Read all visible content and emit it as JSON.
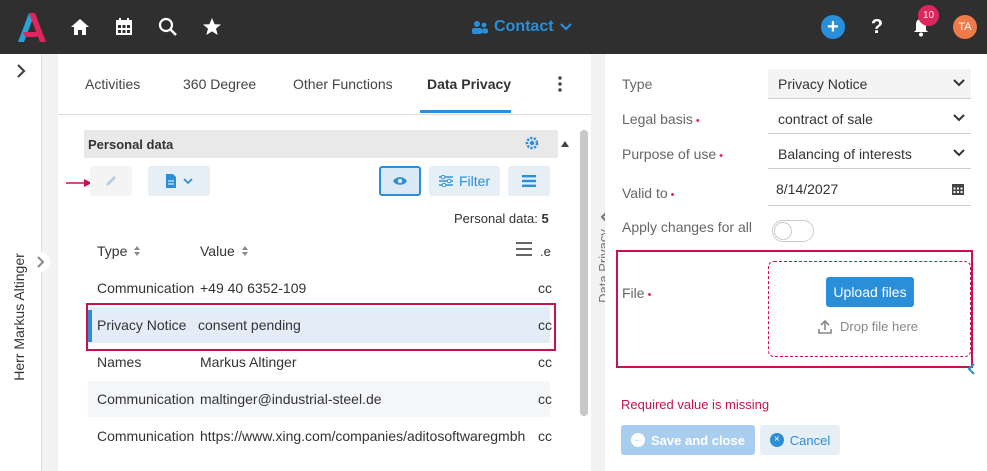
{
  "topbar": {
    "context_label": "Contact",
    "notification_count": "10",
    "user_initials": "TA",
    "icons": [
      "home-icon",
      "calendar-icon",
      "search-icon",
      "star-icon",
      "add-icon",
      "help-icon",
      "bell-icon"
    ],
    "colors": {
      "bar": "#2f2f2f",
      "accent": "#2a8fd8",
      "badge": "#e0245e",
      "avatar": "#ef7b4b"
    }
  },
  "left_rail": {
    "record_name": "Herr Markus Altinger"
  },
  "tabs": [
    {
      "label": "Activities"
    },
    {
      "label": "360 Degree"
    },
    {
      "label": "Other Functions"
    },
    {
      "label": "Data Privacy",
      "active": true
    }
  ],
  "section": {
    "title": "Personal data",
    "toolbar": {
      "filter_label": "Filter"
    },
    "count_label": "Personal data:",
    "count_value": "5"
  },
  "table": {
    "columns": [
      "Type",
      "Value",
      ".e"
    ],
    "rows": [
      {
        "type": "Communication",
        "value": "+49 40 6352-109",
        "extra": "cc"
      },
      {
        "type": "Privacy Notice",
        "value": "consent pending",
        "extra": "cc",
        "selected": true
      },
      {
        "type": "Names",
        "value": "Markus Altinger",
        "extra": "cc"
      },
      {
        "type": "Communication",
        "value": "maltinger@industrial-steel.de",
        "extra": "cc"
      },
      {
        "type": "Communication",
        "value": "https://www.xing.com/companies/aditosoftwaregmbh",
        "extra": "cc"
      }
    ]
  },
  "splitter": {
    "label": "Data Privacy"
  },
  "form": {
    "type_label": "Type",
    "type_value": "Privacy Notice",
    "legal_basis_label": "Legal basis",
    "legal_basis_value": "contract of sale",
    "purpose_label": "Purpose of use",
    "purpose_value": "Balancing of interests",
    "valid_to_label": "Valid to",
    "valid_to_value": "8/14/2027",
    "apply_label": "Apply changes for all",
    "apply_value": false,
    "file_label": "File",
    "upload_label": "Upload files",
    "drop_label": "Drop file here",
    "error_text": "Required value is missing",
    "required_marker": "•",
    "save_label": "Save and close",
    "cancel_label": "Cancel"
  }
}
